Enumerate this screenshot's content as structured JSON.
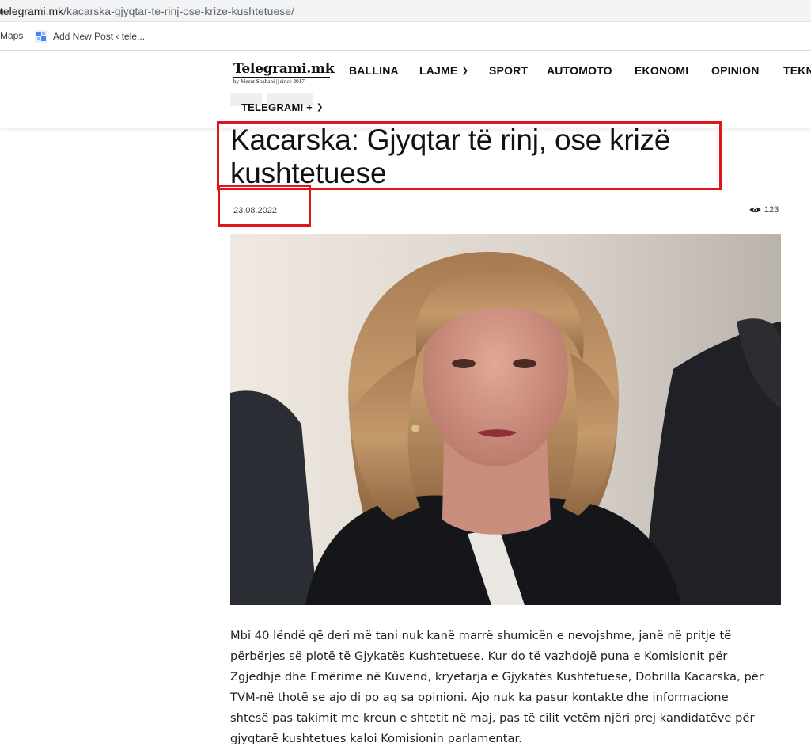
{
  "browser": {
    "url_host": "telegrami.mk",
    "url_path": "/kacarska-gjyqtar-te-rinj-ose-krize-kushtetuese/",
    "bookmarks": [
      "Maps",
      "Add New Post ‹ tele..."
    ]
  },
  "site": {
    "logo_title": "Telegrami.mk",
    "logo_subtitle": "by Mesut Shabani || since 2017",
    "nav": [
      {
        "label": "BALLINA"
      },
      {
        "label": "LAJME"
      },
      {
        "label": "SPORT"
      },
      {
        "label": "AUTOMOTO"
      },
      {
        "label": "EKONOMI"
      },
      {
        "label": "OPINION"
      },
      {
        "label": "TEKN"
      }
    ],
    "nav_second": "TELEGRAMI +"
  },
  "article": {
    "title": "Kacarska: Gjyqtar të rinj, ose krizë kushtetuese",
    "date": "23.08.2022",
    "views": "123",
    "body": "Mbi 40 lëndë që deri më tani nuk kanë marrë shumicën e nevojshme, janë në pritje të përbërjes së plotë të Gjykatës Kushtetuese. Kur do të vazhdojë puna e Komisionit për Zgjedhje dhe Emërime në Kuvend, kryetarja e Gjykatës Kushtetuese, Dobrilla Kacarska, për TVM-në thotë se ajo di po aq sa opinioni. Ajo nuk ka pasur kontakte dhe informacione shtesë pas takimit me kreun e shtetit në maj, pas të cilit vetëm njëri prej kandidatëve për gjyqtarë kushtetues kaloi Komisionin parlamentar."
  },
  "colors": {
    "highlight": "#e0151b"
  },
  "icons": [
    "lock-icon",
    "wordpress-icon",
    "chevron-down-icon",
    "eye-icon"
  ]
}
